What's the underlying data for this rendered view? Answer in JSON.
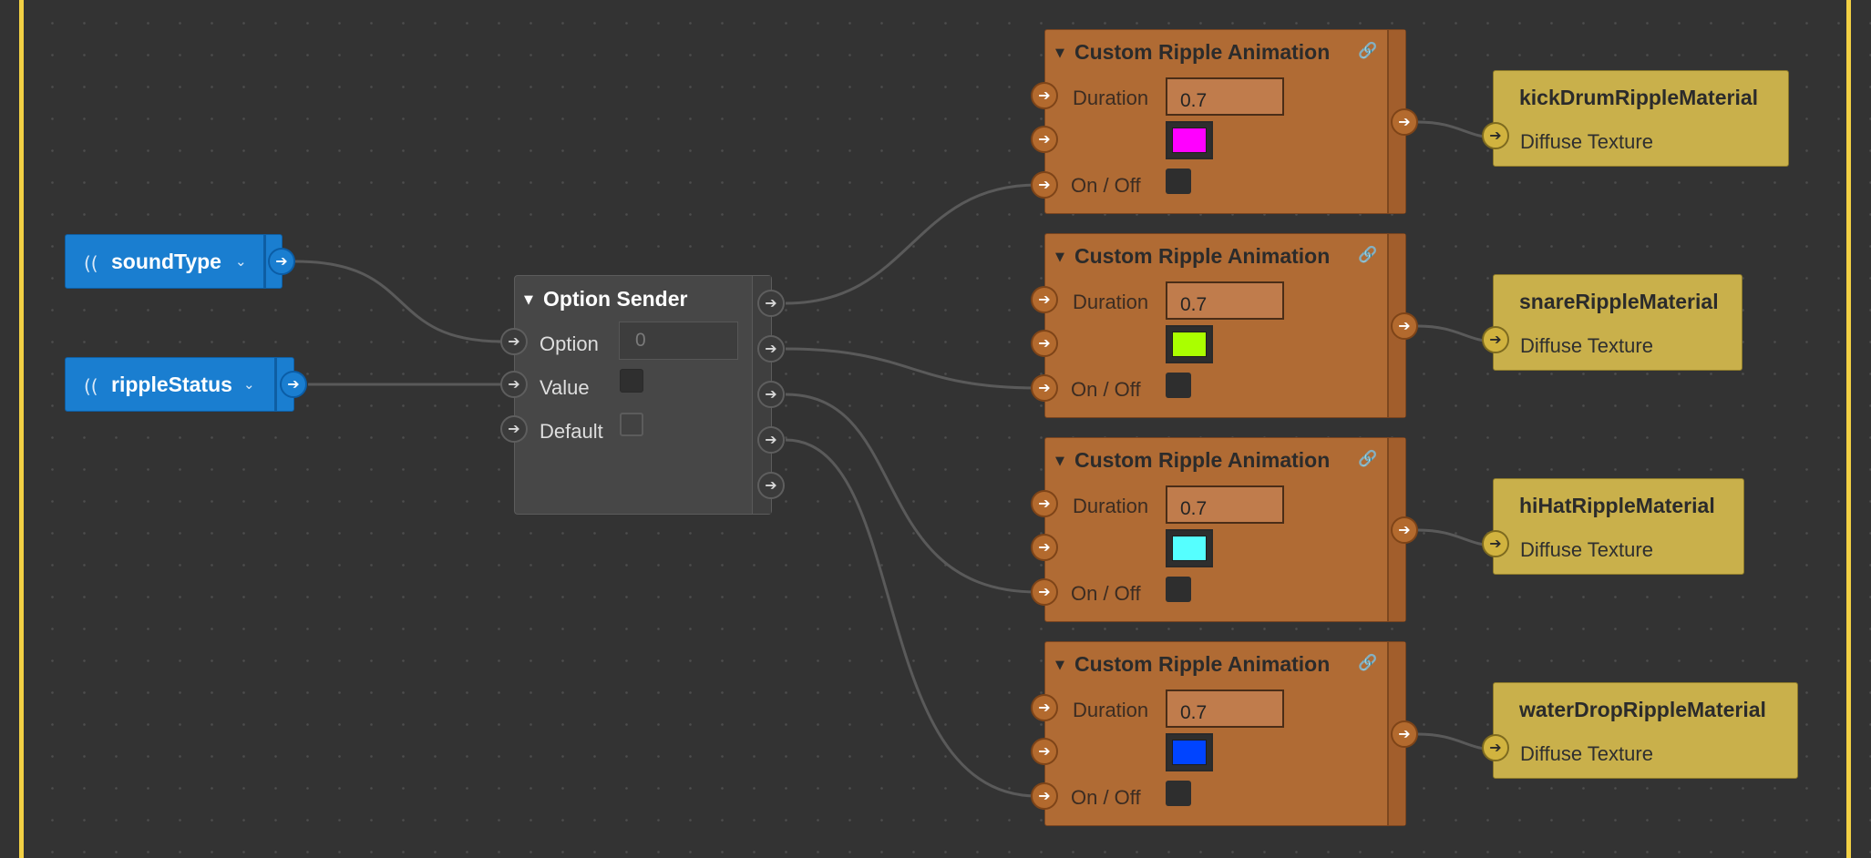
{
  "graph": {
    "variables": [
      {
        "label": "soundType"
      },
      {
        "label": "rippleStatus"
      }
    ],
    "option_sender": {
      "title": "Option Sender",
      "option_label": "Option",
      "option_placeholder": "0",
      "value_label": "Value",
      "default_label": "Default"
    },
    "ripple_nodes": [
      {
        "title": "Custom Ripple Animation",
        "duration_label": "Duration",
        "duration_value": "0.7",
        "color": "#ff00ff",
        "toggle_label": "On / Off"
      },
      {
        "title": "Custom Ripple Animation",
        "duration_label": "Duration",
        "duration_value": "0.7",
        "color": "#aaff00",
        "toggle_label": "On / Off"
      },
      {
        "title": "Custom Ripple Animation",
        "duration_label": "Duration",
        "duration_value": "0.7",
        "color": "#55ffff",
        "toggle_label": "On / Off"
      },
      {
        "title": "Custom Ripple Animation",
        "duration_label": "Duration",
        "duration_value": "0.7",
        "color": "#0044ff",
        "toggle_label": "On / Off"
      }
    ],
    "materials": [
      {
        "name": "kickDrumRippleMaterial",
        "input_label": "Diffuse Texture"
      },
      {
        "name": "snareRippleMaterial",
        "input_label": "Diffuse Texture"
      },
      {
        "name": "hiHatRippleMaterial",
        "input_label": "Diffuse Texture"
      },
      {
        "name": "waterDropRippleMaterial",
        "input_label": "Diffuse Texture"
      }
    ]
  },
  "icons": {
    "variable": "broadcast-icon",
    "dropdown": "chevron-down-icon",
    "collapse": "triangle-down-icon",
    "link": "link-icon",
    "port": "arrow-right-icon"
  },
  "colors": {
    "frame": "#f2d044",
    "variable_node": "#1a7ed0",
    "ripple_node": "#b06b34",
    "material_node": "#c9b04b",
    "option_node": "#474747"
  }
}
